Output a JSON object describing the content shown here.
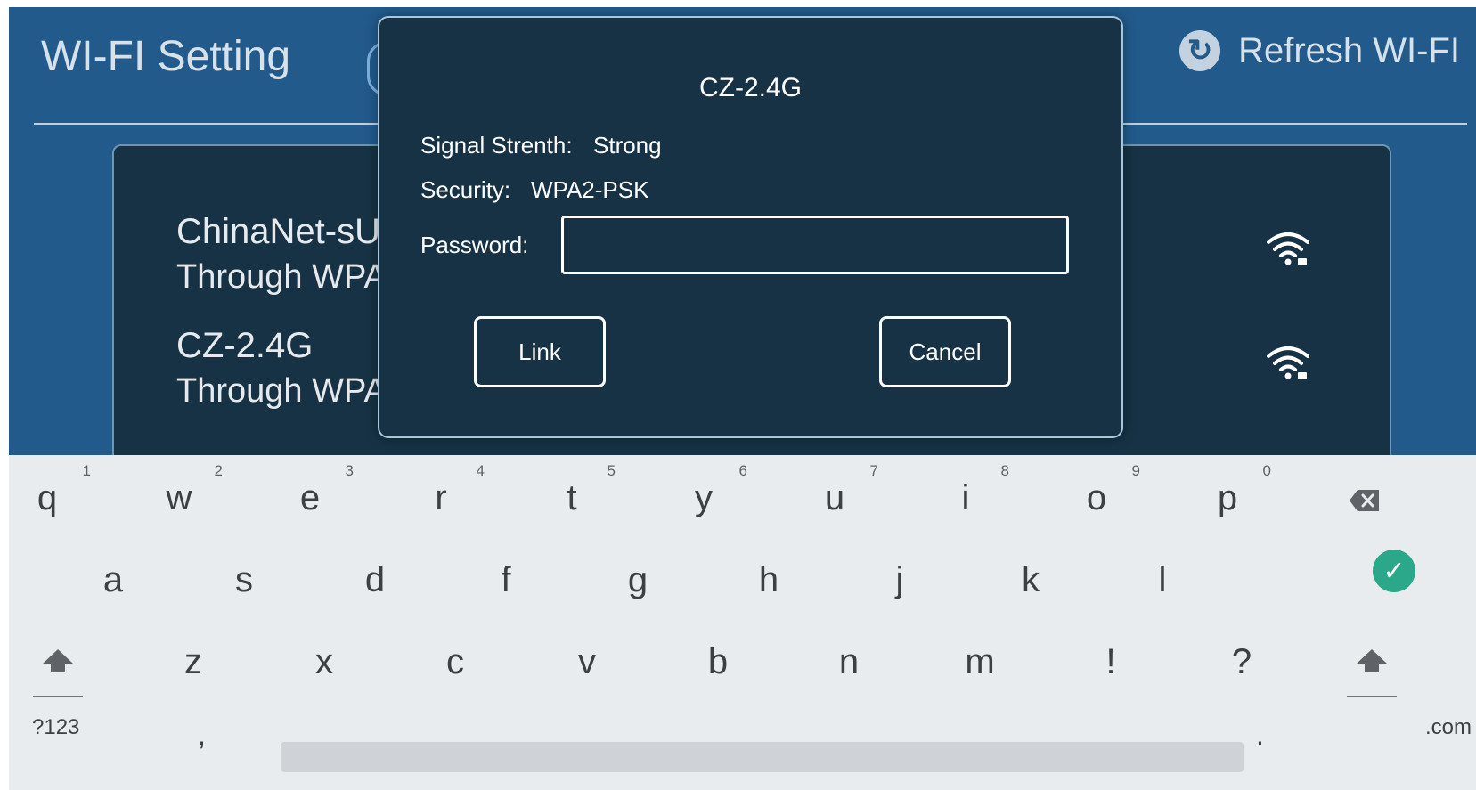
{
  "app": {
    "title": "WI-FI Setting",
    "refresh_label": "Refresh WI-FI",
    "refresh_icon": "refresh-icon",
    "networks": [
      {
        "name": "ChinaNet-sU",
        "security": "Through WPA",
        "icon": "wifi-locked-icon"
      },
      {
        "name": "CZ-2.4G",
        "security": "Through WPA",
        "icon": "wifi-locked-icon"
      }
    ]
  },
  "dialog": {
    "title": "CZ-2.4G",
    "signal_label": "Signal Strenth:",
    "signal_value": "Strong",
    "security_label": "Security:",
    "security_value": "WPA2-PSK",
    "password_label": "Password:",
    "password_value": "",
    "link_label": "Link",
    "cancel_label": "Cancel"
  },
  "keyboard": {
    "row1": [
      {
        "char": "q",
        "hint": "1"
      },
      {
        "char": "w",
        "hint": "2"
      },
      {
        "char": "e",
        "hint": "3"
      },
      {
        "char": "r",
        "hint": "4"
      },
      {
        "char": "t",
        "hint": "5"
      },
      {
        "char": "y",
        "hint": "6"
      },
      {
        "char": "u",
        "hint": "7"
      },
      {
        "char": "i",
        "hint": "8"
      },
      {
        "char": "o",
        "hint": "9"
      },
      {
        "char": "p",
        "hint": "0"
      }
    ],
    "row2": [
      "a",
      "s",
      "d",
      "f",
      "g",
      "h",
      "j",
      "k",
      "l"
    ],
    "row3": [
      "z",
      "x",
      "c",
      "v",
      "b",
      "n",
      "m",
      "!",
      "?"
    ],
    "symbols_label": "?123",
    "comma": ",",
    "period": ".",
    "dotcom_label": ".com",
    "backspace_icon": "backspace-icon",
    "enter_icon": "check-icon",
    "shift_icon": "shift-icon"
  },
  "colors": {
    "app_background": "#225a8c",
    "panel_background": "#163244",
    "keyboard_background": "#e9ecef",
    "enter_key": "#2aa889"
  }
}
